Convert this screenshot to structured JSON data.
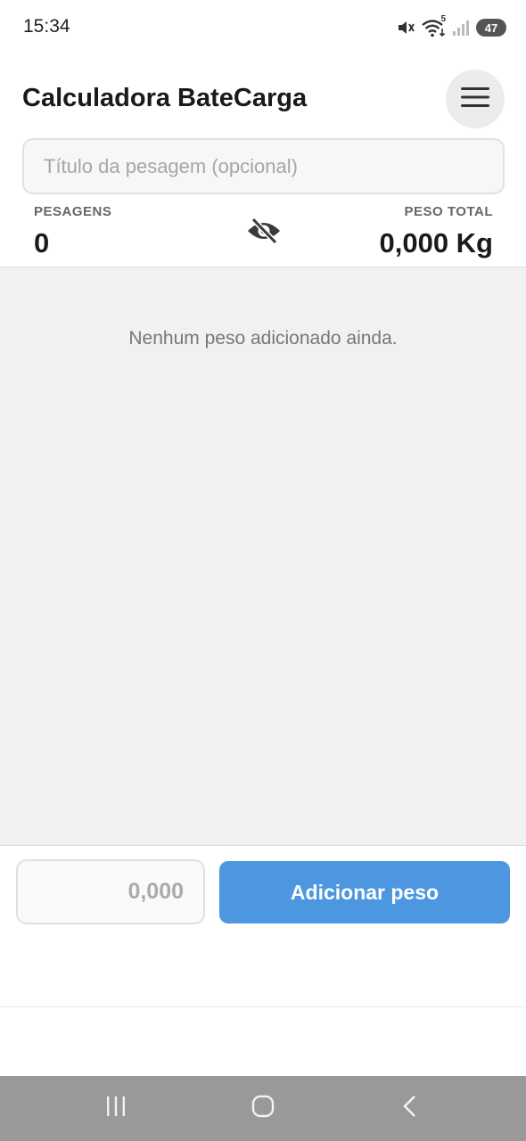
{
  "status_bar": {
    "time": "15:34",
    "wifi_label": "5",
    "battery": "47",
    "icons": [
      "mute-icon",
      "wifi-icon",
      "signal-icon",
      "battery-icon"
    ]
  },
  "header": {
    "title": "Calculadora BateCarga",
    "menu_icon": "hamburger-menu-icon"
  },
  "title_input": {
    "placeholder": "Título da pesagem (opcional)",
    "value": ""
  },
  "stats": {
    "count_label": "PESAGENS",
    "count_value": "0",
    "total_label": "PESO TOTAL",
    "total_value": "0,000 Kg",
    "visibility_icon": "eye-off-icon"
  },
  "list": {
    "empty_message": "Nenhum peso adicionado ainda."
  },
  "entry": {
    "weight_placeholder": "0,000",
    "weight_value": "",
    "add_label": "Adicionar peso"
  },
  "nav": {
    "icons": [
      "recent-apps-icon",
      "home-icon",
      "back-icon"
    ]
  },
  "colors": {
    "accent": "#4c97e0",
    "list_background": "#f1f1f1",
    "nav_bar": "#999999"
  }
}
